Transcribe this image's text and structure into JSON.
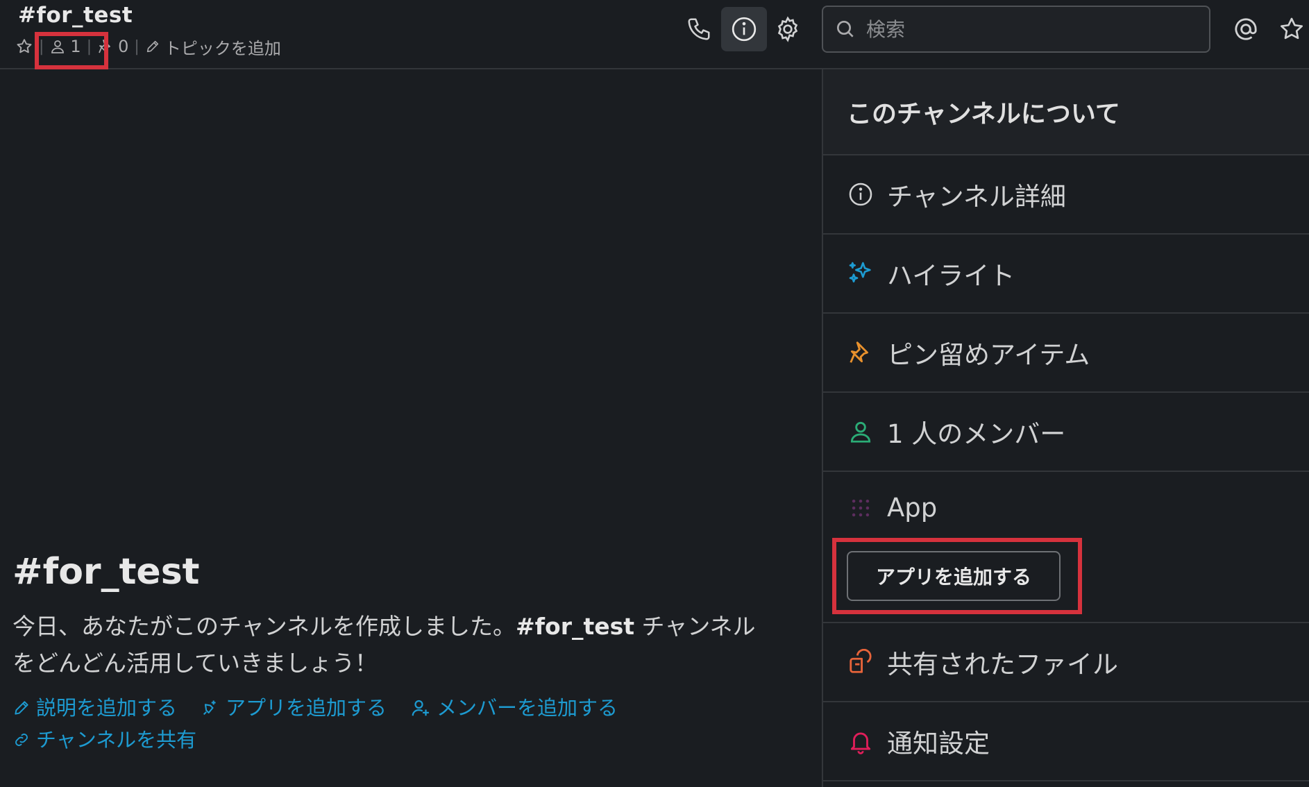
{
  "header": {
    "channel_title": "#for_test",
    "member_count": "1",
    "pin_count": "0",
    "add_topic": "トピックを追加",
    "search_placeholder": "検索"
  },
  "intro": {
    "title": "#for_test",
    "desc_before": "今日、あなたがこのチャンネルを作成しました。",
    "desc_channel": "#for_test",
    "desc_after": " チャンネルをどんどん活用していきましょう！",
    "actions": {
      "add_description": "説明を追加する",
      "add_app": "アプリを追加する",
      "add_member": "メンバーを追加する",
      "share_channel": "チャンネルを共有"
    }
  },
  "panel": {
    "title": "このチャンネルについて",
    "details": "チャンネル詳細",
    "highlights": "ハイライト",
    "pinned": "ピン留めアイテム",
    "members": "1 人のメンバー",
    "app_label": "App",
    "add_app_button": "アプリを追加する",
    "shared_files": "共有されたファイル",
    "notification_settings": "通知設定"
  },
  "colors": {
    "background": "#1a1d21",
    "link": "#1d9bd1",
    "highlight_box": "#d6323d",
    "highlights_icon": "#1d9bd1",
    "pin_icon": "#e8912d",
    "member_icon": "#2bac76",
    "app_icon": "#4a154b",
    "files_icon": "#e8643a",
    "bell_icon": "#e01e5a"
  },
  "icons": {
    "star": "star-icon",
    "member": "person-icon",
    "pin": "pin-icon",
    "pencil": "pencil-icon",
    "phone": "phone-icon",
    "info": "info-icon",
    "settings": "gear-icon",
    "search": "search-icon",
    "mention": "at-icon",
    "saved": "star-icon",
    "highlights": "sparkle-icon",
    "apps": "app-grid-icon",
    "files": "files-icon",
    "notifications": "bell-icon",
    "link": "link-icon",
    "add_member": "add-person-icon"
  }
}
